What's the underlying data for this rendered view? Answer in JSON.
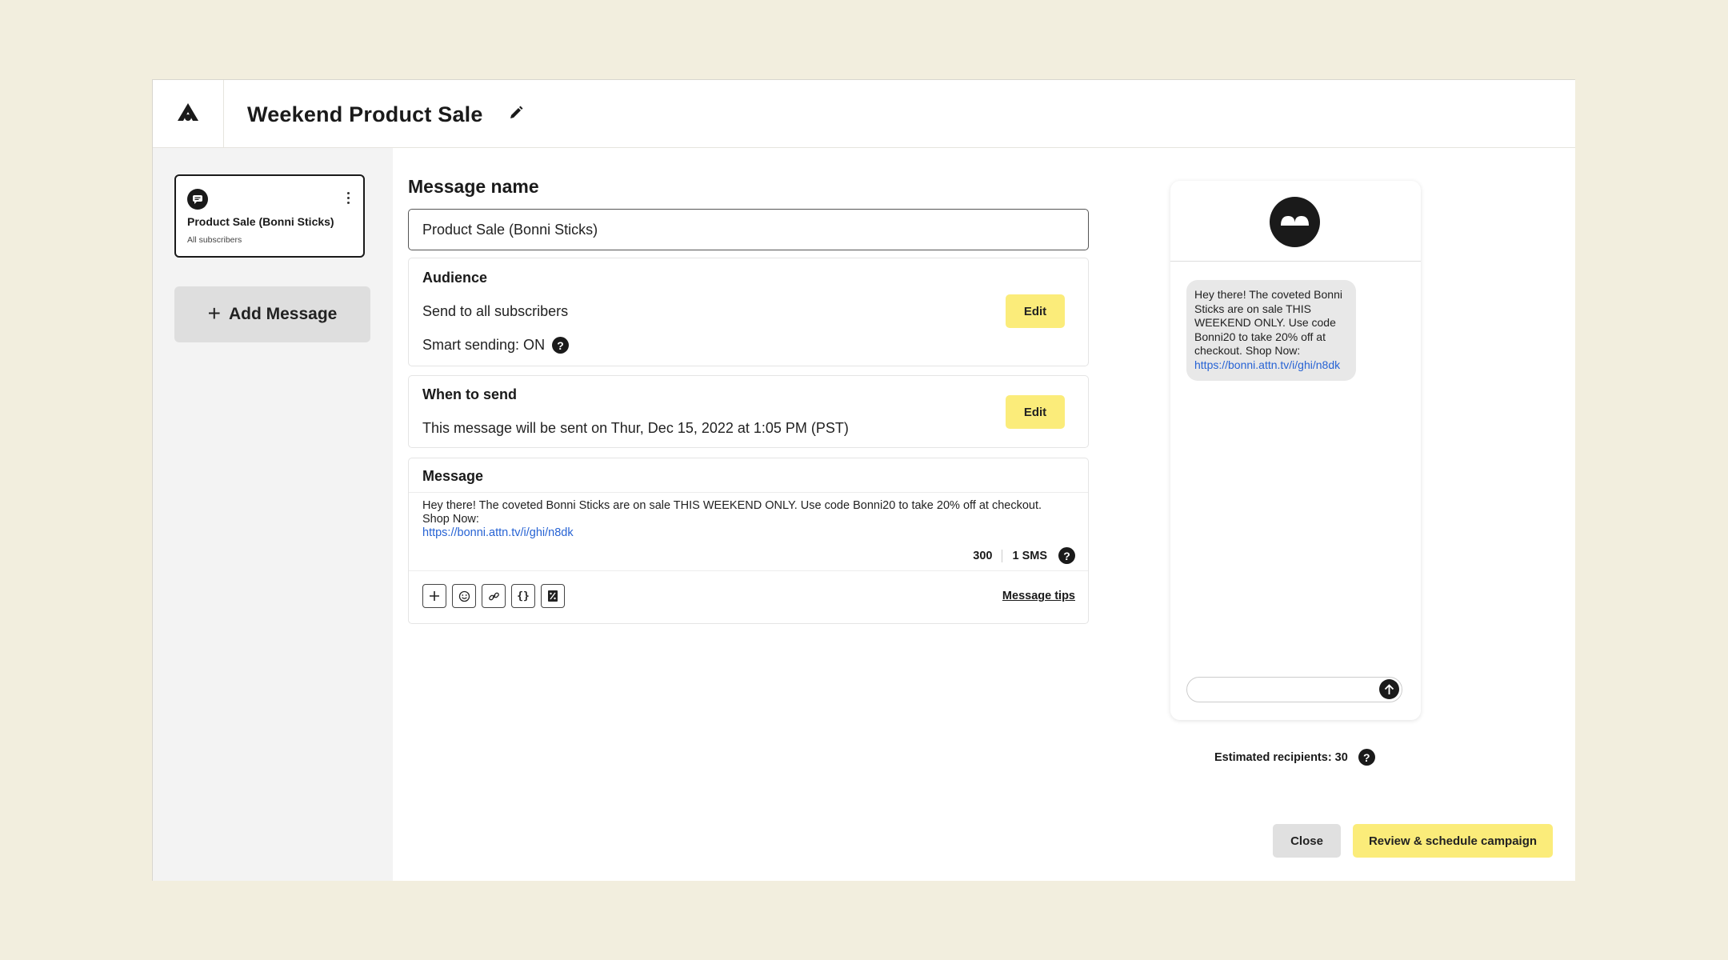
{
  "app": {
    "campaign_title": "Weekend Product Sale",
    "logo_icon": "attentive-logo-icon",
    "edit_icon": "pencil-icon"
  },
  "sidebar": {
    "messages": [
      {
        "title": "Product Sale (Bonni Sticks)",
        "subtitle": "All subscribers",
        "icon": "chat-bubble-icon"
      }
    ],
    "add_message_label": "Add Message"
  },
  "editor": {
    "message_name_label": "Message name",
    "message_name_value": "Product Sale (Bonni Sticks)",
    "audience": {
      "title": "Audience",
      "send_to": "Send to all subscribers",
      "smart_sending": "Smart sending: ON",
      "edit_label": "Edit"
    },
    "when_to_send": {
      "title": "When to send",
      "text": "This message will be sent on Thur, Dec 15, 2022 at 1:05 PM (PST)",
      "edit_label": "Edit"
    },
    "message": {
      "title": "Message",
      "body": "Hey there! The coveted Bonni Sticks are on sale THIS WEEKEND ONLY. Use code Bonni20 to take 20% off at checkout. Shop Now:",
      "link": "https://bonni.attn.tv/i/ghi/n8dk",
      "char_count": "300",
      "sms_count": "1 SMS",
      "tips_label": "Message tips",
      "tools": [
        "plus-icon",
        "emoji-icon",
        "link-icon",
        "braces-icon",
        "discount-icon"
      ]
    }
  },
  "preview": {
    "bubble_text": "Hey there! The coveted Bonni Sticks are on sale THIS WEEKEND ONLY. Use code Bonni20 to take 20% off at checkout. Shop Now:",
    "bubble_link": "https://bonni.attn.tv/i/ghi/n8dk",
    "estimated_recipients": "Estimated recipients: 30"
  },
  "footer": {
    "close_label": "Close",
    "review_label": "Review & schedule campaign"
  },
  "colors": {
    "background": "#f2eede",
    "accent_yellow": "#fbec7a",
    "link_blue": "#2763d4",
    "dark": "#1a1a1a"
  }
}
